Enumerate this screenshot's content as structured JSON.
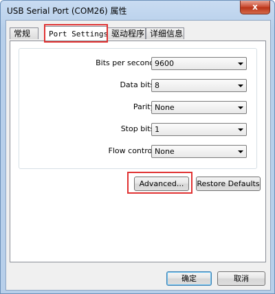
{
  "window": {
    "title": "USB Serial Port (COM26) 属性",
    "close_label": "x"
  },
  "tabs": [
    {
      "label": "常规",
      "active": false
    },
    {
      "label": "Port Settings",
      "active": true
    },
    {
      "label": "驱动程序",
      "active": false
    },
    {
      "label": "详细信息",
      "active": false
    }
  ],
  "settings": {
    "bits_per_second": {
      "label": "Bits per second:",
      "value": "9600"
    },
    "data_bits": {
      "label": "Data bits:",
      "value": "8"
    },
    "parity": {
      "label": "Parity:",
      "value": "None"
    },
    "stop_bits": {
      "label": "Stop bits:",
      "value": "1"
    },
    "flow_control": {
      "label": "Flow control:",
      "value": "None"
    }
  },
  "buttons": {
    "advanced": "Advanced...",
    "restore_defaults": "Restore Defaults",
    "ok": "确定",
    "cancel": "取消"
  },
  "colors": {
    "highlight": "#e03030",
    "title_bar": "#b7cfea"
  }
}
